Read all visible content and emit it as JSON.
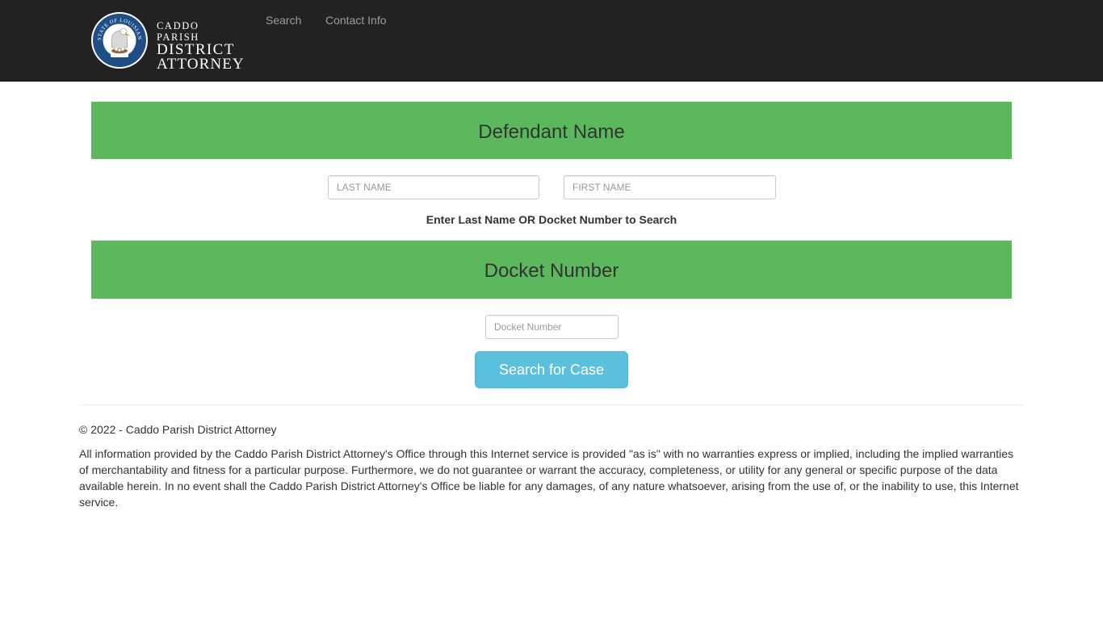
{
  "header": {
    "logo": {
      "seal_text": "STATE OF LOUISIANA",
      "line1": "CADDO PARISH",
      "line2": "DISTRICT",
      "line3": "ATTORNEY"
    },
    "nav": {
      "search": "Search",
      "contact": "Contact Info"
    }
  },
  "defendant_section": {
    "title": "Defendant Name",
    "last_name_placeholder": "LAST NAME",
    "first_name_placeholder": "FIRST NAME",
    "last_name_value": "",
    "first_name_value": ""
  },
  "hint": "Enter Last Name OR Docket Number to Search",
  "docket_section": {
    "title": "Docket Number",
    "placeholder": "Docket Number",
    "value": ""
  },
  "search_button": "Search for Case",
  "footer": {
    "copyright": "© 2022 - Caddo Parish District Attorney",
    "disclaimer": "All information provided by the Caddo Parish District Attorney's Office through this Internet service is provided \"as is\" with no warranties express or implied, including the implied warranties of merchantability and fitness for a particular purpose. Furthermore, we do not guarantee or warrant the accuracy, completeness, or utility for any general or specific purpose of the data available herein. In no event shall the Caddo Parish District Attorney's Office be liable for any damages, of any nature whatsoever, arising from the use of, or the inability to use, this Internet service."
  },
  "colors": {
    "navbar_bg": "#222222",
    "panel_green": "#5cb85c",
    "button_info": "#5bc0de",
    "nav_link": "#9d9d9d"
  }
}
